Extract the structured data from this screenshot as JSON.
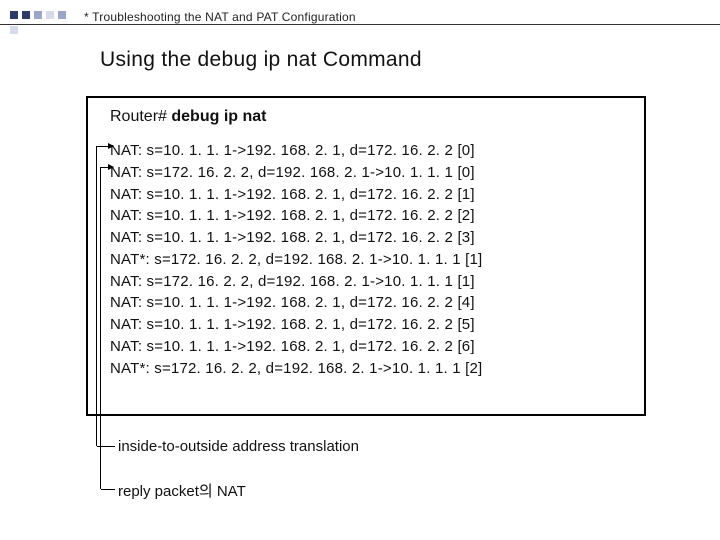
{
  "header": {
    "crumb": "* Troubleshooting the NAT and PAT Configuration"
  },
  "title": "Using the debug ip nat Command",
  "terminal": {
    "prompt": "Router#",
    "command": "debug ip nat",
    "output": [
      "NAT: s=10. 1. 1. 1->192. 168. 2. 1, d=172. 16. 2. 2 [0]",
      "NAT: s=172. 16. 2. 2, d=192. 168. 2. 1->10. 1. 1. 1 [0]",
      "NAT: s=10. 1. 1. 1->192. 168. 2. 1, d=172. 16. 2. 2 [1]",
      "NAT: s=10. 1. 1. 1->192. 168. 2. 1, d=172. 16. 2. 2 [2]",
      "NAT: s=10. 1. 1. 1->192. 168. 2. 1, d=172. 16. 2. 2 [3]",
      "NAT*: s=172. 16. 2. 2, d=192. 168. 2. 1->10. 1. 1. 1 [1]",
      "NAT: s=172. 16. 2. 2, d=192. 168. 2. 1->10. 1. 1. 1 [1]",
      "NAT: s=10. 1. 1. 1->192. 168. 2. 1, d=172. 16. 2. 2 [4]",
      "NAT: s=10. 1. 1. 1->192. 168. 2. 1, d=172. 16. 2. 2 [5]",
      "NAT: s=10. 1. 1. 1->192. 168. 2. 1, d=172. 16. 2. 2 [6]",
      "NAT*: s=172. 16. 2. 2, d=192. 168. 2. 1->10. 1. 1. 1 [2]"
    ]
  },
  "annotations": {
    "inside_outside": "inside-to-outside address translation",
    "reply_packet": "reply  packet의 NAT"
  }
}
